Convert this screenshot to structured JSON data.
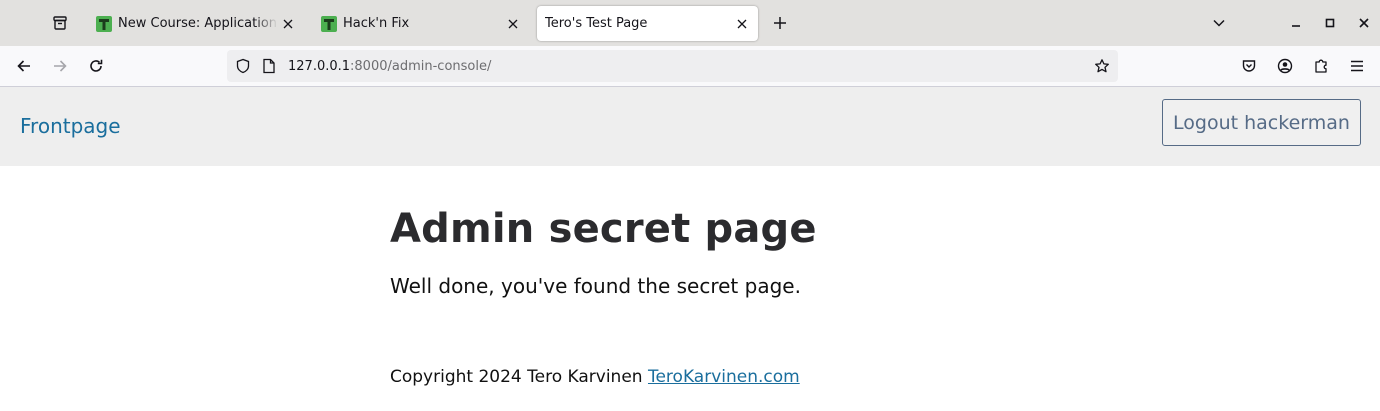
{
  "browser": {
    "tabs": [
      {
        "title": "New Course: Application H",
        "active": false,
        "favicon": "tero-t-icon"
      },
      {
        "title": "Hack'n Fix",
        "active": false,
        "favicon": "tero-t-icon"
      },
      {
        "title": "Tero's Test Page",
        "active": true,
        "favicon": ""
      }
    ],
    "url": {
      "host": "127.0.0.1",
      "rest": ":8000/admin-console/"
    },
    "colors": {
      "favicon_green": "#4caf50",
      "favicon_dark": "#2e7d32"
    }
  },
  "site": {
    "nav_home": "Frontpage",
    "logout_label": "Logout hackerman",
    "link_color": "#1a6e9d"
  },
  "main": {
    "heading": "Admin secret page",
    "lead": "Well done, you've found the secret page."
  },
  "footer": {
    "copyright": "Copyright 2024 Tero Karvinen",
    "link_text": "TeroKarvinen.com"
  }
}
